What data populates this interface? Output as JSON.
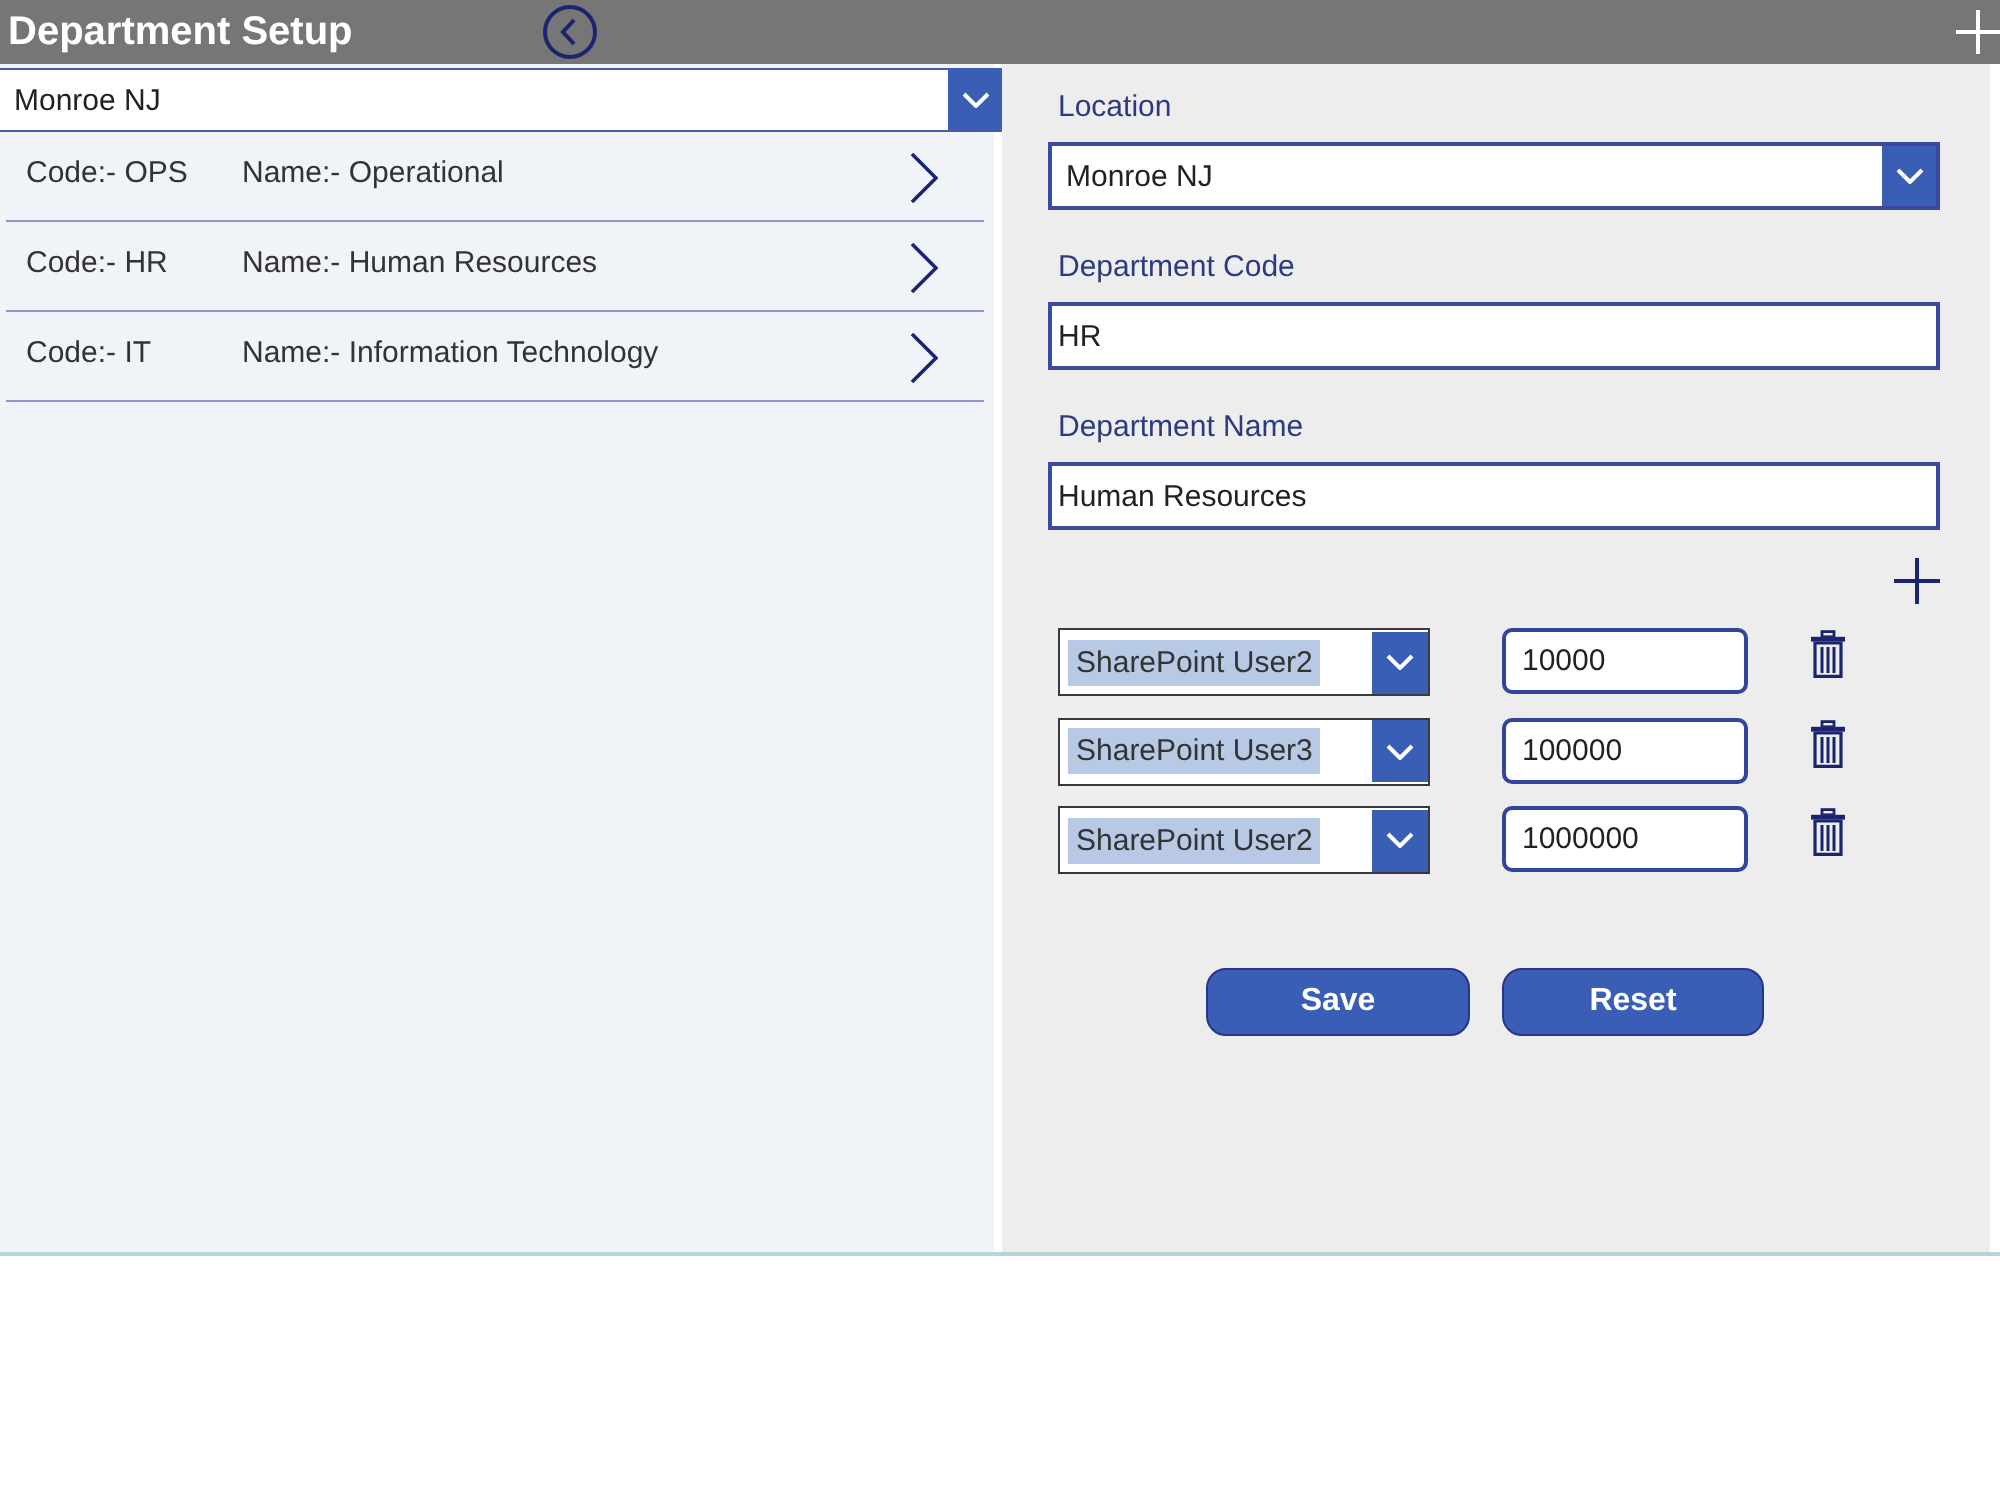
{
  "header": {
    "title": "Department Setup"
  },
  "location_filter": {
    "value": "Monroe NJ"
  },
  "departments": [
    {
      "code": "Code:- OPS",
      "name": "Name:- Operational"
    },
    {
      "code": "Code:- HR",
      "name": "Name:- Human Resources"
    },
    {
      "code": "Code:- IT",
      "name": "Name:- Information Technology"
    }
  ],
  "form": {
    "location": {
      "label": "Location",
      "value": "Monroe NJ"
    },
    "department_code": {
      "label": "Department Code",
      "value": "HR"
    },
    "department_name": {
      "label": "Department Name",
      "value": "Human Resources"
    },
    "approvers": [
      {
        "user": "SharePoint User2",
        "amount": "10000"
      },
      {
        "user": "SharePoint User3",
        "amount": "100000"
      },
      {
        "user": "SharePoint User2",
        "amount": "1000000"
      }
    ]
  },
  "buttons": [
    "Save",
    "Reset"
  ]
}
